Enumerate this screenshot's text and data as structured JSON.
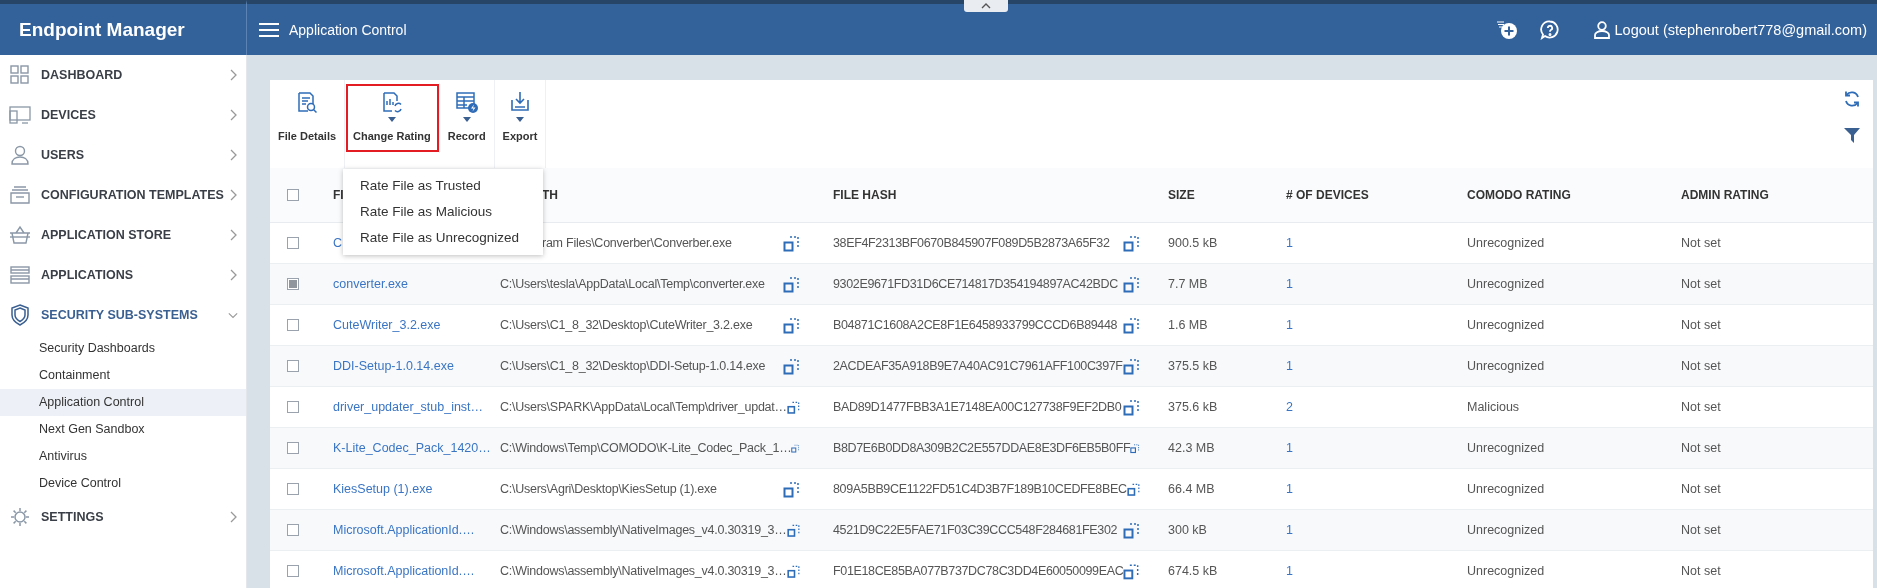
{
  "app": {
    "title": "Endpoint Manager"
  },
  "topbar": {
    "page_title": "Application Control",
    "logout": "Logout (stephenrobert778@gmail.com)"
  },
  "sidebar": {
    "items": [
      {
        "label": "DASHBOARD",
        "expanded": false
      },
      {
        "label": "DEVICES",
        "expanded": false
      },
      {
        "label": "USERS",
        "expanded": false
      },
      {
        "label": "CONFIGURATION TEMPLATES",
        "expanded": false
      },
      {
        "label": "APPLICATION STORE",
        "expanded": false
      },
      {
        "label": "APPLICATIONS",
        "expanded": false
      },
      {
        "label": "SECURITY SUB-SYSTEMS",
        "expanded": true,
        "children": [
          {
            "label": "Security Dashboards",
            "selected": false
          },
          {
            "label": "Containment",
            "selected": false
          },
          {
            "label": "Application Control",
            "selected": true
          },
          {
            "label": "Next Gen Sandbox",
            "selected": false
          },
          {
            "label": "Antivirus",
            "selected": false
          },
          {
            "label": "Device Control",
            "selected": false
          }
        ]
      },
      {
        "label": "SETTINGS",
        "expanded": false
      }
    ]
  },
  "toolbar": {
    "buttons": [
      {
        "label": "File Details",
        "has_menu": false,
        "highlighted": false
      },
      {
        "label": "Change Rating",
        "has_menu": true,
        "highlighted": true
      },
      {
        "label": "Record",
        "has_menu": true,
        "highlighted": false
      },
      {
        "label": "Export",
        "has_menu": true,
        "highlighted": false
      }
    ],
    "menu": {
      "open": true,
      "items": [
        "Rate File as Trusted",
        "Rate File as Malicious",
        "Rate File as Unrecognized"
      ]
    }
  },
  "table": {
    "select_all_checked": false,
    "columns": [
      "FI",
      "TH",
      "FILE HASH",
      "SIZE",
      "# OF DEVICES",
      "COMODO RATING",
      "ADMIN RATING"
    ],
    "rows": [
      {
        "checked": false,
        "name": "C",
        "path": "ram Files\\Converber\\Converber.exe",
        "hash": "38EF4F2313BF0670B845907F089D5B2873A65F32",
        "size": "900.5 kB",
        "devices": "1",
        "comodo_rating": "Unrecognized",
        "admin_rating": "Not set"
      },
      {
        "checked": true,
        "name": "converter.exe",
        "path": "C:\\Users\\tesla\\AppData\\Local\\Temp\\converter.exe",
        "hash": "9302E9671FD31D6CE714817D354194897AC42BDC",
        "size": "7.7 MB",
        "devices": "1",
        "comodo_rating": "Unrecognized",
        "admin_rating": "Not set"
      },
      {
        "checked": false,
        "name": "CuteWriter_3.2.exe",
        "path": "C:\\Users\\C1_8_32\\Desktop\\CuteWriter_3.2.exe",
        "hash": "B04871C1608A2CE8F1E6458933799CCCD6B89448",
        "size": "1.6 MB",
        "devices": "1",
        "comodo_rating": "Unrecognized",
        "admin_rating": "Not set"
      },
      {
        "checked": false,
        "name": "DDI-Setup-1.0.14.exe",
        "path": "C:\\Users\\C1_8_32\\Desktop\\DDI-Setup-1.0.14.exe",
        "hash": "2ACDEAF35A918B9E7A40AC91C7961AFF100C397F",
        "size": "375.5 kB",
        "devices": "1",
        "comodo_rating": "Unrecognized",
        "admin_rating": "Not set"
      },
      {
        "checked": false,
        "name": "driver_updater_stub_inst…",
        "path": "C:\\Users\\SPARK\\AppData\\Local\\Temp\\driver_updat…",
        "hash": "BAD89D1477FBB3A1E7148EA00C127738F9EF2DB0",
        "size": "375.6 kB",
        "devices": "2",
        "comodo_rating": "Malicious",
        "admin_rating": "Not set"
      },
      {
        "checked": false,
        "name": "K-Lite_Codec_Pack_1420…",
        "path": "C:\\Windows\\Temp\\COMODO\\K-Lite_Codec_Pack_1…",
        "hash": "B8D7E6B0DD8A309B2C2E557DDAE8E3DF6EB5B0FF",
        "size": "42.3 MB",
        "devices": "1",
        "comodo_rating": "Unrecognized",
        "admin_rating": "Not set"
      },
      {
        "checked": false,
        "name": "KiesSetup (1).exe",
        "path": "C:\\Users\\Agri\\Desktop\\KiesSetup (1).exe",
        "hash": "809A5BB9CE1122FD51C4D3B7F189B10CEDFE8BEC",
        "size": "66.4 MB",
        "devices": "1",
        "comodo_rating": "Unrecognized",
        "admin_rating": "Not set"
      },
      {
        "checked": false,
        "name": "Microsoft.ApplicationId.…",
        "path": "C:\\Windows\\assembly\\NativeImages_v4.0.30319_3…",
        "hash": "4521D9C22E5FAE71F03C39CCC548F284681FE302",
        "size": "300 kB",
        "devices": "1",
        "comodo_rating": "Unrecognized",
        "admin_rating": "Not set"
      },
      {
        "checked": false,
        "name": "Microsoft.ApplicationId.…",
        "path": "C:\\Windows\\assembly\\NativeImages_v4.0.30319_3…",
        "hash": "F01E18CE85BA077B737DC78C3DD4E60050099EAC",
        "size": "674.5 kB",
        "devices": "1",
        "comodo_rating": "Unrecognized",
        "admin_rating": "Not set"
      }
    ]
  }
}
